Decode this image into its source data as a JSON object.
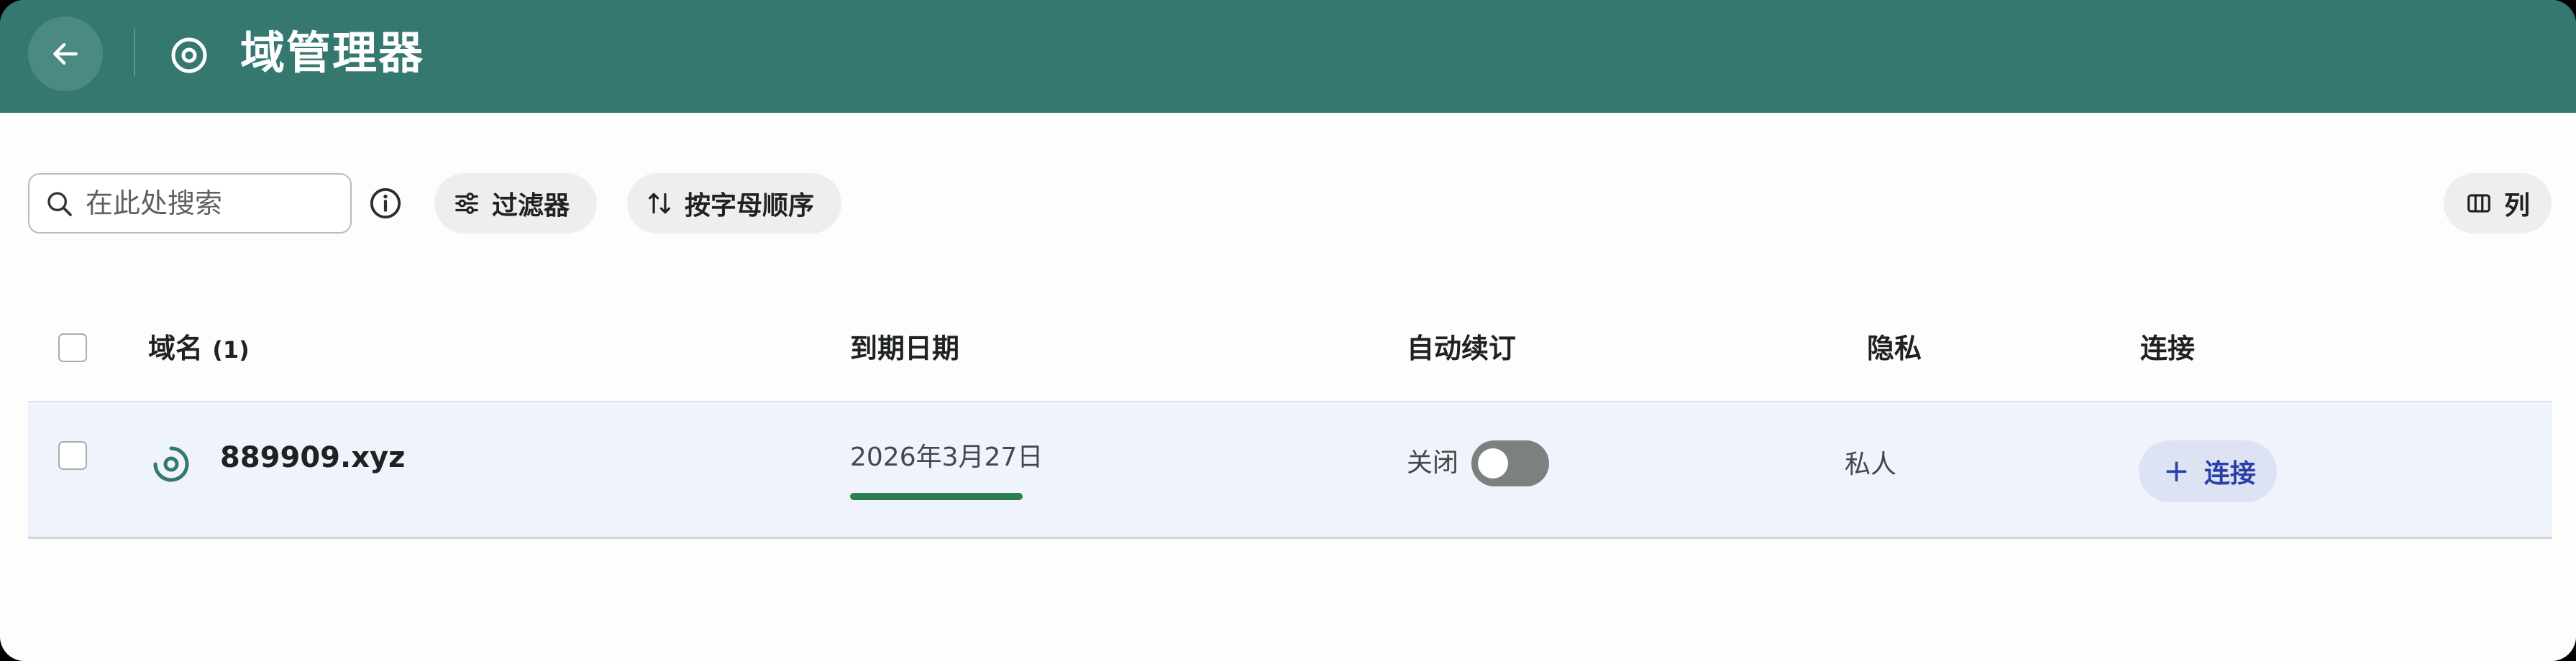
{
  "header": {
    "title": "域管理器",
    "back_icon": "arrow-left-icon",
    "logo_icon": "domain-target-icon",
    "color": "#347870"
  },
  "toolbar": {
    "search": {
      "placeholder": "在此处搜索",
      "value": ""
    },
    "info_icon": "info-icon",
    "filter_label": "过滤器",
    "sort_label": "按字母顺序",
    "columns_label": "列"
  },
  "table": {
    "columns": {
      "domain": "域名",
      "domain_count": "(1)",
      "expiry": "到期日期",
      "auto_renew": "自动续订",
      "privacy": "隐私",
      "connect": "连接"
    },
    "rows": [
      {
        "domain": "889909.xyz",
        "expiry": "2026年3月27日",
        "auto_renew_label": "关闭",
        "auto_renew_on": false,
        "privacy": "私人",
        "connect_label": "连接",
        "selected": false
      }
    ]
  },
  "colors": {
    "accent": "#347870",
    "row_highlight": "#eef3fc",
    "connect_text": "#2a3fa8",
    "expiry_bar": "#2e7d4f"
  }
}
